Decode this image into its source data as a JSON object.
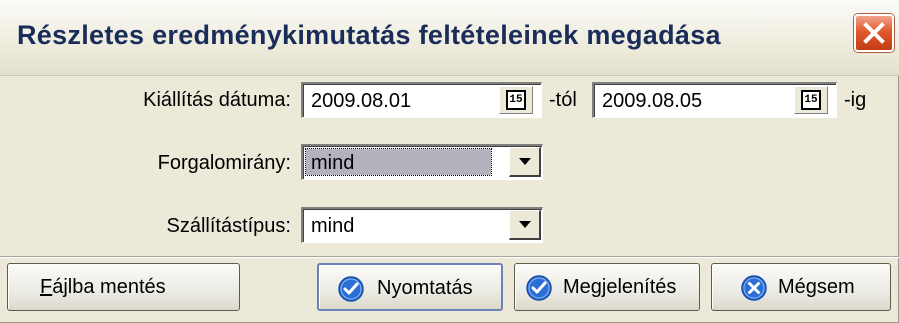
{
  "window": {
    "title": "Részletes eredménykimutatás feltételeinek megadása"
  },
  "form": {
    "issue_date_label": "Kiállítás dátuma:",
    "date_from": "2009.08.01",
    "from_suffix": "-tól",
    "date_to": "2009.08.05",
    "to_suffix": "-ig",
    "calendar_icon_text": "15",
    "direction_label": "Forgalomirány:",
    "direction_value": "mind",
    "shipping_type_label": "Szállítástípus:",
    "shipping_type_value": "mind"
  },
  "buttons": {
    "save_to_file_mnemonic": "F",
    "save_to_file_rest": "ájlba mentés",
    "print": "Nyomtatás",
    "display": "Megjelenítés",
    "cancel": "Mégsem"
  },
  "colors": {
    "check_icon": "#2b6fd6",
    "cancel_icon": "#2b6fd6",
    "close_button": "#e0592e"
  }
}
